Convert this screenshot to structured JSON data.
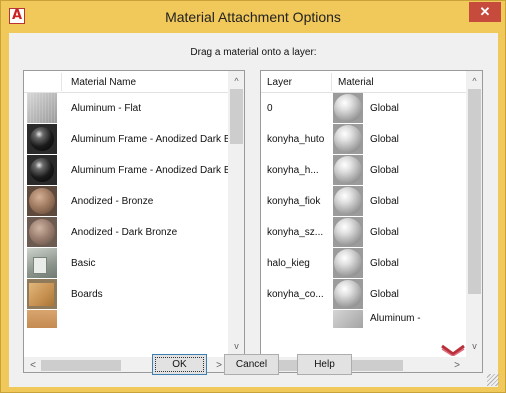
{
  "window": {
    "title": "Material Attachment Options",
    "app_icon_letter": "A",
    "close_glyph": "✕"
  },
  "instruction": "Drag a material onto a layer:",
  "materials_list": {
    "column_header": "Material Name",
    "items": [
      {
        "label": "Aluminum - Flat",
        "swatch": "flat-metal"
      },
      {
        "label": "Aluminum Frame - Anodized Dark B",
        "swatch": "black-sphere"
      },
      {
        "label": "Aluminum Frame - Anodized Dark B",
        "swatch": "black-sphere"
      },
      {
        "label": "Anodized - Bronze",
        "swatch": "bronze-sphere"
      },
      {
        "label": "Anodized - Dark Bronze",
        "swatch": "dark-bronze-sphere"
      },
      {
        "label": "Basic",
        "swatch": "basic-scene"
      },
      {
        "label": "Boards",
        "swatch": "boards-cube"
      },
      {
        "label": "",
        "swatch": "partial"
      }
    ]
  },
  "layers_list": {
    "column_headers": [
      "Layer",
      "Material"
    ],
    "rows": [
      {
        "layer": "0",
        "material": "Global",
        "swatch": "grey-sphere"
      },
      {
        "layer": "konyha_huto",
        "material": "Global",
        "swatch": "grey-sphere"
      },
      {
        "layer": "konyha_h...",
        "material": "Global",
        "swatch": "grey-sphere"
      },
      {
        "layer": "konyha_fiok",
        "material": "Global",
        "swatch": "grey-sphere"
      },
      {
        "layer": "konyha_sz...",
        "material": "Global",
        "swatch": "grey-sphere"
      },
      {
        "layer": "halo_kieg",
        "material": "Global",
        "swatch": "grey-sphere"
      },
      {
        "layer": "konyha_co...",
        "material": "Global",
        "swatch": "grey-sphere"
      },
      {
        "layer": "",
        "material": "Aluminum -",
        "swatch": "metal"
      }
    ]
  },
  "buttons": {
    "ok": "OK",
    "cancel": "Cancel",
    "help": "Help"
  },
  "icons": {
    "up_arrow": "^",
    "down_arrow": "v",
    "left_arrow": "<",
    "right_arrow": ">"
  },
  "colors": {
    "title_bar": "#f1c85a",
    "close_button": "#c74b3c",
    "dialog_body": "#f0f0f0"
  }
}
